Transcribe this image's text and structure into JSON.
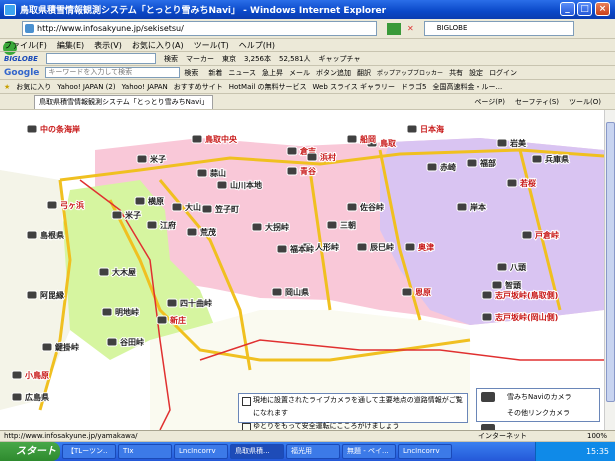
{
  "window": {
    "title": "鳥取県積雪情報観測システム「とっとり雪みちNavi」 - Windows Internet Explorer"
  },
  "address": {
    "url": "http://www.infosakyune.jp/sekisetsu/",
    "search_brand": "BIGLOBE"
  },
  "menu": [
    "ファイル(F)",
    "編集(E)",
    "表示(V)",
    "お気に入り(A)",
    "ツール(T)",
    "ヘルプ(H)"
  ],
  "toolbar1": {
    "brand": "BIGLOBE",
    "search": "検索",
    "marker": "マーカー",
    "tokyo": "東京",
    "weather1": "3,256本",
    "weather2": "52,581人",
    "cap": "ギャップチャ"
  },
  "toolbar2": {
    "google": "Google",
    "placeholder": "キーワードを入力して検索",
    "search": "検索",
    "items": [
      "新着",
      "ニュース",
      "急上昇",
      "メール",
      "ボタン追加",
      "翻訳",
      "ポップアップブロッカー",
      "共有",
      "設定",
      "ログイン"
    ]
  },
  "favorites": {
    "label": "お気に入り",
    "items": [
      "Yahoo! JAPAN (2)",
      "Yahoo! JAPAN",
      "おすすめサイト",
      "HotMail の無料サービス",
      "Web スライス ギャラリー",
      "ドラゴ5",
      "全国高速料金・ルー..."
    ]
  },
  "tab": {
    "title": "鳥取県積雪情報観測システム「とっとり雪みちNavi」"
  },
  "ie_tools": {
    "page": "ページ(P)",
    "safety": "セーフティ(S)",
    "tools": "ツール(O)"
  },
  "map": {
    "labels": [
      {
        "t": "中の条海岸",
        "c": "#c81818"
      },
      {
        "t": "鳥取中央",
        "c": "#c81818"
      },
      {
        "t": "弓ヶ浜",
        "c": "#c81818"
      },
      {
        "t": "米子",
        "c": "#222"
      },
      {
        "t": "倉吉",
        "c": "#c81818"
      },
      {
        "t": "米子",
        "c": "#222"
      },
      {
        "t": "山川本地",
        "c": "#222"
      },
      {
        "t": "横原",
        "c": "#222"
      },
      {
        "t": "大山",
        "c": "#222"
      },
      {
        "t": "蒜山",
        "c": "#222"
      },
      {
        "t": "荒茂",
        "c": "#222"
      },
      {
        "t": "笠子町",
        "c": "#222"
      },
      {
        "t": "江府",
        "c": "#222"
      },
      {
        "t": "佐谷峠",
        "c": "#222"
      },
      {
        "t": "三朝",
        "c": "#222"
      },
      {
        "t": "大拐峠",
        "c": "#222"
      },
      {
        "t": "人形峠",
        "c": "#222"
      },
      {
        "t": "辰巳峠",
        "c": "#222"
      },
      {
        "t": "福本峠",
        "c": "#222"
      },
      {
        "t": "鳥取",
        "c": "#c81818"
      },
      {
        "t": "日本海",
        "c": "#c81818"
      },
      {
        "t": "兵庫県",
        "c": "#222"
      },
      {
        "t": "若桜",
        "c": "#c81818"
      },
      {
        "t": "戸倉峠",
        "c": "#c81818"
      },
      {
        "t": "岡山県",
        "c": "#222"
      },
      {
        "t": "島根県",
        "c": "#222"
      },
      {
        "t": "広島県",
        "c": "#222"
      },
      {
        "t": "阿毘縁",
        "c": "#222"
      },
      {
        "t": "大木屋",
        "c": "#222"
      },
      {
        "t": "明地峠",
        "c": "#222"
      },
      {
        "t": "四十曲峠",
        "c": "#222"
      },
      {
        "t": "新庄",
        "c": "#c81818"
      },
      {
        "t": "谷田峠",
        "c": "#222"
      },
      {
        "t": "鍵掛峠",
        "c": "#222"
      },
      {
        "t": "小鳥原",
        "c": "#c81818"
      },
      {
        "t": "志戸坂峠(鳥取側)",
        "c": "#c81818"
      },
      {
        "t": "志戸坂峠(岡山側)",
        "c": "#c81818"
      },
      {
        "t": "恩原",
        "c": "#c81818"
      },
      {
        "t": "奥津",
        "c": "#c81818"
      },
      {
        "t": "船岡",
        "c": "#c81818"
      },
      {
        "t": "八頭",
        "c": "#222"
      },
      {
        "t": "智頭",
        "c": "#222"
      },
      {
        "t": "岩美",
        "c": "#222"
      },
      {
        "t": "福部",
        "c": "#222"
      },
      {
        "t": "浜村",
        "c": "#c81818"
      },
      {
        "t": "青谷",
        "c": "#c81818"
      },
      {
        "t": "岸本",
        "c": "#222"
      },
      {
        "t": "赤崎",
        "c": "#222"
      }
    ],
    "notice": [
      "現地に設置されたライブカメラを通して主要地点の道路情報がご覧になれます",
      "ゆとりをもって安全運転にこころがけましょう"
    ],
    "legend": [
      "雪みちNaviのカメラ",
      "その他リンクカメラ"
    ]
  },
  "status": {
    "url": "http://www.infosakyune.jp/yamakawa/",
    "zone": "インターネット",
    "zoom": "100%"
  },
  "taskbar": {
    "start": "スタート",
    "tasks": [
      "【TLーツン..",
      "TIx",
      "LncIncorrv",
      "鳥取県積...",
      "福光用",
      "無題 - ペイ...",
      "LncIncorrv"
    ],
    "time": "15:35"
  },
  "colors": {
    "west": "#d6f5a0",
    "central": "#f9c8d8",
    "east": "#d9c4f2",
    "sea": "#ffffff",
    "road": "#f0c020"
  }
}
